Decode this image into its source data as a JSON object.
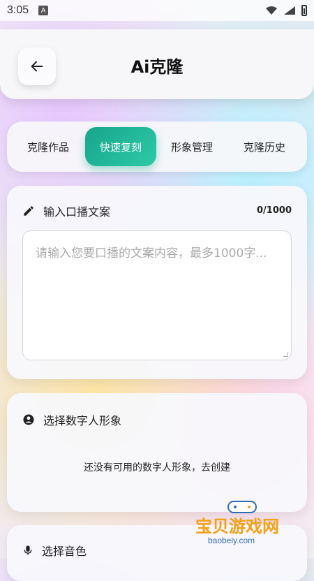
{
  "status_bar": {
    "time": "3:05",
    "notif_icon_letter": "A"
  },
  "header": {
    "title": "Ai克隆"
  },
  "tabs": [
    {
      "label": "克隆作品",
      "active": false
    },
    {
      "label": "快速复刻",
      "active": true
    },
    {
      "label": "形象管理",
      "active": false
    },
    {
      "label": "克隆历史",
      "active": false
    }
  ],
  "script_card": {
    "title": "输入口播文案",
    "counter": "0/1000",
    "placeholder": "请输入您要口播的文案内容，最多1000字..."
  },
  "avatar_card": {
    "title": "选择数字人形象",
    "empty_text": "还没有可用的数字人形象，去创建"
  },
  "voice_card": {
    "title": "选择音色"
  },
  "watermark": {
    "title": "宝贝游戏网",
    "url": "baobeiy.com"
  },
  "colors": {
    "accent": "#18a58c"
  }
}
